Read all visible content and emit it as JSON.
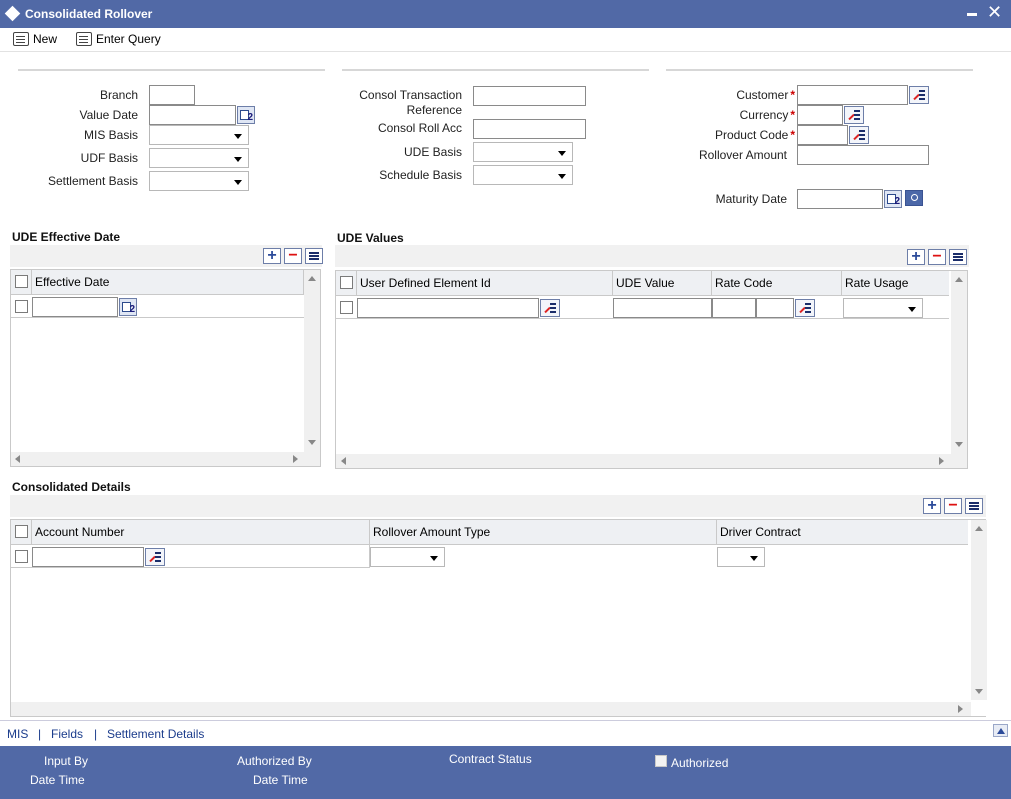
{
  "window": {
    "title": "Consolidated Rollover"
  },
  "toolbar": {
    "new_label": "New",
    "enter_query_label": "Enter Query"
  },
  "form": {
    "branch_label": "Branch",
    "value_date_label": "Value Date",
    "mis_basis_label": "MIS Basis",
    "udf_basis_label": "UDF Basis",
    "settlement_basis_label": "Settlement Basis",
    "consol_txn_ref_label_1": "Consol Transaction",
    "consol_txn_ref_label_2": "Reference",
    "consol_roll_acc_label": "Consol Roll Acc",
    "ude_basis_label": "UDE Basis",
    "schedule_basis_label": "Schedule Basis",
    "customer_label": "Customer",
    "currency_label": "Currency",
    "product_code_label": "Product Code",
    "rollover_amount_label": "Rollover Amount",
    "maturity_date_label": "Maturity Date",
    "required_mark": "*"
  },
  "ude_effective": {
    "title": "UDE Effective Date",
    "columns": [
      "Effective Date"
    ]
  },
  "ude_values": {
    "title": "UDE Values",
    "columns": [
      "User Defined Element Id",
      "UDE Value",
      "Rate Code",
      "Rate Usage"
    ]
  },
  "consolidated": {
    "title": "Consolidated Details",
    "columns": [
      "Account Number",
      "Rollover Amount Type",
      "Driver Contract"
    ]
  },
  "links": [
    "MIS",
    "Fields",
    "Settlement Details"
  ],
  "link_sep": "|",
  "footer": {
    "input_by": "Input By",
    "date_time_1": "Date Time",
    "authorized_by": "Authorized By",
    "date_time_2": "Date Time",
    "contract_status": "Contract Status",
    "authorized": "Authorized"
  },
  "colors": {
    "header_blue": "#5169a6",
    "link_blue": "#1b3c8c",
    "required_red": "#cc0000"
  }
}
